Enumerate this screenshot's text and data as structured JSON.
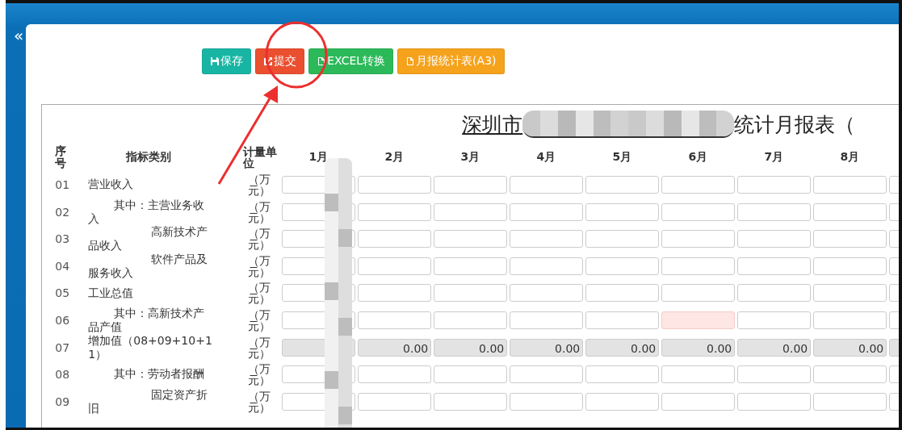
{
  "sidebar": {
    "collapse": "«"
  },
  "toolbar": [
    {
      "kind": "save",
      "label": "保存"
    },
    {
      "kind": "submit",
      "label": "提交"
    },
    {
      "kind": "export",
      "label": "EXCEL转换"
    },
    {
      "kind": "report",
      "label": "月报统计表(A3)"
    }
  ],
  "annotation": {
    "circle": true,
    "arrow": true
  },
  "report": {
    "title_start": "深圳市",
    "title_redacted": true,
    "title_end": "统计月报表（",
    "columns": {
      "seq": "序号",
      "category": "指标类别",
      "unit": "计量单位",
      "months": [
        "1月",
        "2月",
        "3月",
        "4月",
        "5月",
        "6月",
        "7月",
        "8月"
      ]
    },
    "first_month_redacted": true,
    "rows": [
      {
        "seq": "01",
        "kind": "main",
        "label": "营业收入",
        "unit": "（万元）",
        "readonly": false,
        "cells": [
          {
            "error": false
          },
          {
            "error": false
          },
          {
            "error": false
          },
          {
            "error": false
          },
          {
            "error": false
          },
          {
            "error": false
          },
          {
            "error": false
          },
          {
            "error": false
          },
          {
            "error": false
          }
        ]
      },
      {
        "seq": "02",
        "kind": "sub",
        "label": "其中：主营业务收入",
        "unit": "（万元）",
        "readonly": false,
        "cells": [
          {
            "error": false
          },
          {
            "error": false
          },
          {
            "error": false
          },
          {
            "error": false
          },
          {
            "error": false
          },
          {
            "error": false
          },
          {
            "error": false
          },
          {
            "error": false
          },
          {
            "error": false
          }
        ]
      },
      {
        "seq": "03",
        "kind": "detail",
        "label": "高新技术产品收入",
        "unit": "（万元）",
        "readonly": false,
        "cells": [
          {
            "error": false
          },
          {
            "error": false
          },
          {
            "error": false
          },
          {
            "error": false
          },
          {
            "error": false
          },
          {
            "error": false
          },
          {
            "error": false
          },
          {
            "error": false
          },
          {
            "error": false
          }
        ]
      },
      {
        "seq": "04",
        "kind": "detail",
        "label": "软件产品及服务收入",
        "unit": "（万元）",
        "readonly": false,
        "cells": [
          {
            "error": false
          },
          {
            "error": false
          },
          {
            "error": false
          },
          {
            "error": false
          },
          {
            "error": false
          },
          {
            "error": false
          },
          {
            "error": false
          },
          {
            "error": false
          },
          {
            "error": false
          }
        ]
      },
      {
        "seq": "05",
        "kind": "main",
        "label": "工业总值",
        "unit": "（万元）",
        "readonly": false,
        "cells": [
          {
            "error": false
          },
          {
            "error": false
          },
          {
            "error": false
          },
          {
            "error": false
          },
          {
            "error": false
          },
          {
            "error": false
          },
          {
            "error": false
          },
          {
            "error": false
          },
          {
            "error": false
          }
        ]
      },
      {
        "seq": "06",
        "kind": "sub",
        "label": "其中：高新技术产品产值",
        "unit": "（万元）",
        "readonly": false,
        "cells": [
          {
            "error": false
          },
          {
            "error": false
          },
          {
            "error": false
          },
          {
            "error": false
          },
          {
            "error": false
          },
          {
            "error": true
          },
          {
            "error": false
          },
          {
            "error": false
          },
          {
            "error": false
          }
        ]
      },
      {
        "seq": "07",
        "kind": "main",
        "label": "增加值（08+09+10+11）",
        "unit": "（万元）",
        "readonly": true,
        "cells": [
          {
            "error": false
          },
          {
            "value": "0.00",
            "error": false
          },
          {
            "value": "0.00",
            "error": false
          },
          {
            "value": "0.00",
            "error": false
          },
          {
            "value": "0.00",
            "error": false
          },
          {
            "value": "0.00",
            "error": false
          },
          {
            "value": "0.00",
            "error": false
          },
          {
            "value": "0.00",
            "error": false
          },
          {
            "error": false
          }
        ]
      },
      {
        "seq": "08",
        "kind": "sub",
        "label": "其中：劳动者报酬",
        "unit": "（万元）",
        "readonly": false,
        "cells": [
          {
            "error": false
          },
          {
            "error": false
          },
          {
            "error": false
          },
          {
            "error": false
          },
          {
            "error": false
          },
          {
            "error": false
          },
          {
            "error": false
          },
          {
            "error": false
          },
          {
            "error": false
          }
        ]
      },
      {
        "seq": "09",
        "kind": "detail",
        "label": "固定资产折旧",
        "unit": "（万元）",
        "readonly": false,
        "cells": [
          {
            "error": false
          },
          {
            "error": false
          },
          {
            "error": false
          },
          {
            "error": false
          },
          {
            "error": false
          },
          {
            "error": false
          },
          {
            "error": false
          },
          {
            "error": false
          },
          {
            "error": false
          }
        ]
      }
    ]
  }
}
